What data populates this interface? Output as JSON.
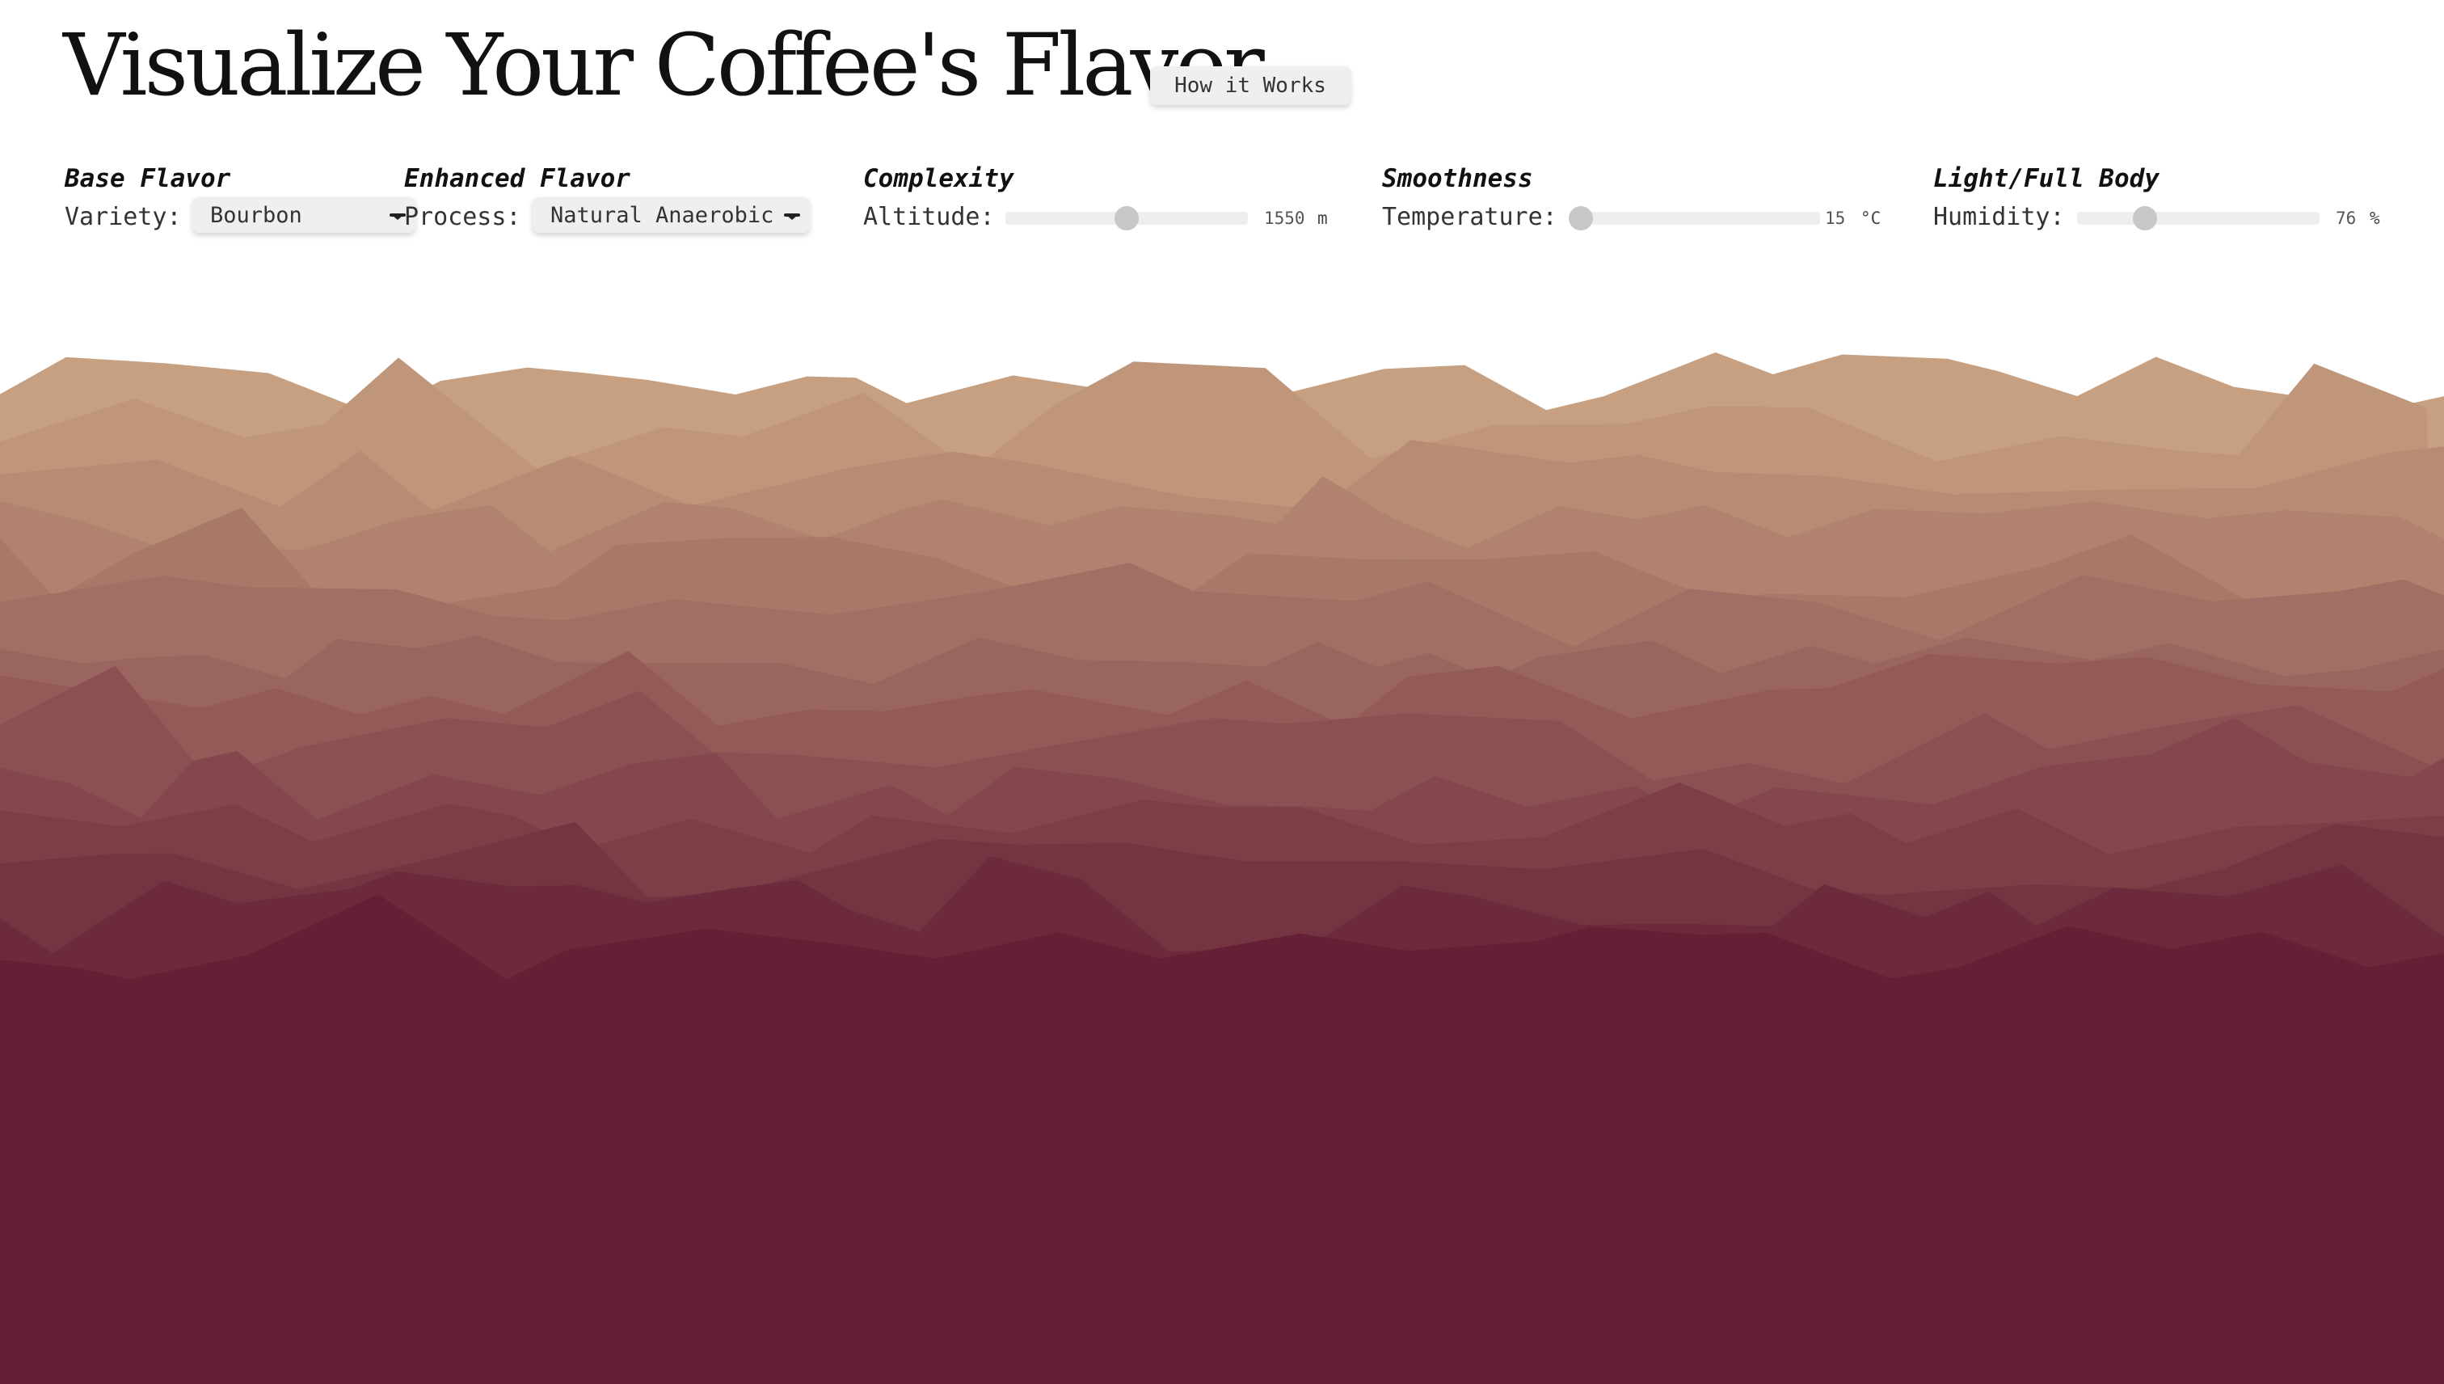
{
  "header": {
    "title": "Visualize Your Coffee's Flavor",
    "how_it_works_label": "How it Works"
  },
  "controls": [
    {
      "kind": "select",
      "title": "Base Flavor",
      "label": "Variety:",
      "value": "Bourbon",
      "icon": "chevron-down-icon"
    },
    {
      "kind": "select",
      "title": "Enhanced Flavor",
      "label": "Process:",
      "value": "Natural Anaerobic",
      "icon": "chevron-down-icon"
    },
    {
      "kind": "slider",
      "title": "Complexity",
      "label": "Altitude:",
      "value": "1550",
      "unit": "m",
      "level": 0.5
    },
    {
      "kind": "slider",
      "title": "Smoothness",
      "label": "Temperature:",
      "value": "15",
      "unit": "°C",
      "level": 0.0
    },
    {
      "kind": "slider",
      "title": "Light/Full Body",
      "label": "Humidity:",
      "value": "76",
      "unit": "%",
      "level": 0.28
    }
  ],
  "visualization": {
    "name": "flavor-landscape",
    "colors": {
      "top": "#c6a080",
      "bottom": "#662036",
      "background": "#ffffff"
    },
    "layer_count": 14
  }
}
